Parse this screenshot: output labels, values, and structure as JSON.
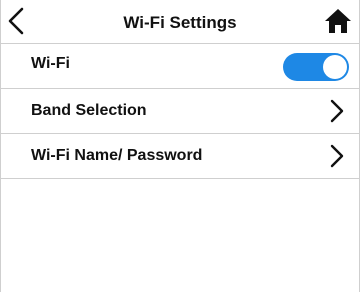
{
  "header": {
    "title": "Wi-Fi Settings",
    "back_icon": "chevron-left-icon",
    "home_icon": "home-icon"
  },
  "wifi": {
    "label": "Wi-Fi",
    "toggle_on": true
  },
  "menu_items": [
    {
      "label": "Band Selection",
      "icon": "chevron-right-icon"
    },
    {
      "label": "Wi-Fi Name/ Password",
      "icon": "chevron-right-icon"
    }
  ],
  "colors": {
    "accent": "#1e88e5",
    "divider": "#cfcfcf",
    "text": "#111111"
  }
}
